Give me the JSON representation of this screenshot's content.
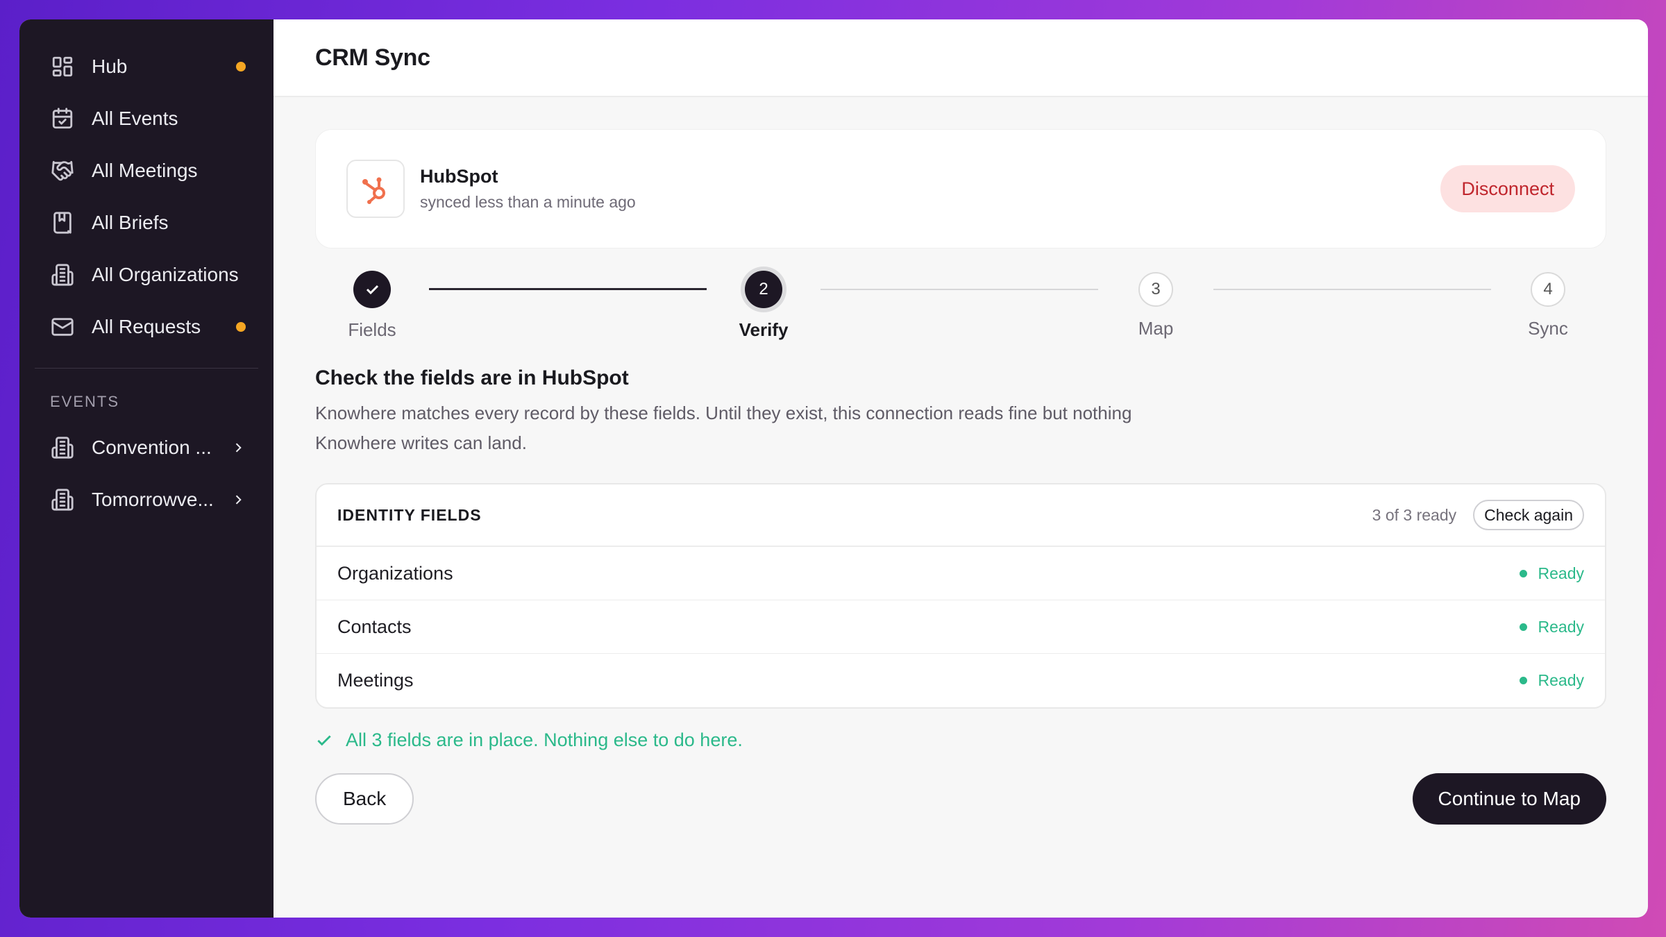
{
  "sidebar": {
    "items": [
      {
        "label": "Hub",
        "icon": "grid-icon",
        "badge": true
      },
      {
        "label": "All Events",
        "icon": "calendar-icon",
        "badge": false
      },
      {
        "label": "All Meetings",
        "icon": "handshake-icon",
        "badge": false
      },
      {
        "label": "All Briefs",
        "icon": "bookmark-icon",
        "badge": false
      },
      {
        "label": "All Organizations",
        "icon": "building-icon",
        "badge": false
      },
      {
        "label": "All Requests",
        "icon": "mail-icon",
        "badge": true
      }
    ],
    "events_heading": "EVENTS",
    "events": [
      {
        "label": "Convention ...",
        "icon": "building-icon"
      },
      {
        "label": "Tomorrowve...",
        "icon": "building-icon"
      }
    ],
    "badge_color": "#f5a623"
  },
  "header": {
    "title": "CRM Sync"
  },
  "integration": {
    "name": "HubSpot",
    "status": "synced less than a minute ago",
    "disconnect_label": "Disconnect",
    "logo_color": "#f0704d"
  },
  "stepper": {
    "steps": [
      {
        "number": "1",
        "label": "Fields",
        "state": "done"
      },
      {
        "number": "2",
        "label": "Verify",
        "state": "active"
      },
      {
        "number": "3",
        "label": "Map",
        "state": "todo"
      },
      {
        "number": "4",
        "label": "Sync",
        "state": "todo"
      }
    ]
  },
  "verify": {
    "title": "Check the fields are in HubSpot",
    "description": "Knowhere matches every record by these fields. Until they exist, this connection reads fine but nothing Knowhere writes can land."
  },
  "identity_fields": {
    "heading": "IDENTITY FIELDS",
    "ready_count": "3 of 3 ready",
    "check_again_label": "Check again",
    "rows": [
      {
        "name": "Organizations",
        "status": "Ready"
      },
      {
        "name": "Contacts",
        "status": "Ready"
      },
      {
        "name": "Meetings",
        "status": "Ready"
      }
    ],
    "status_color": "#2bb98a"
  },
  "success_message": "All 3 fields are in place. Nothing else to do here.",
  "actions": {
    "back_label": "Back",
    "continue_label": "Continue to Map"
  }
}
